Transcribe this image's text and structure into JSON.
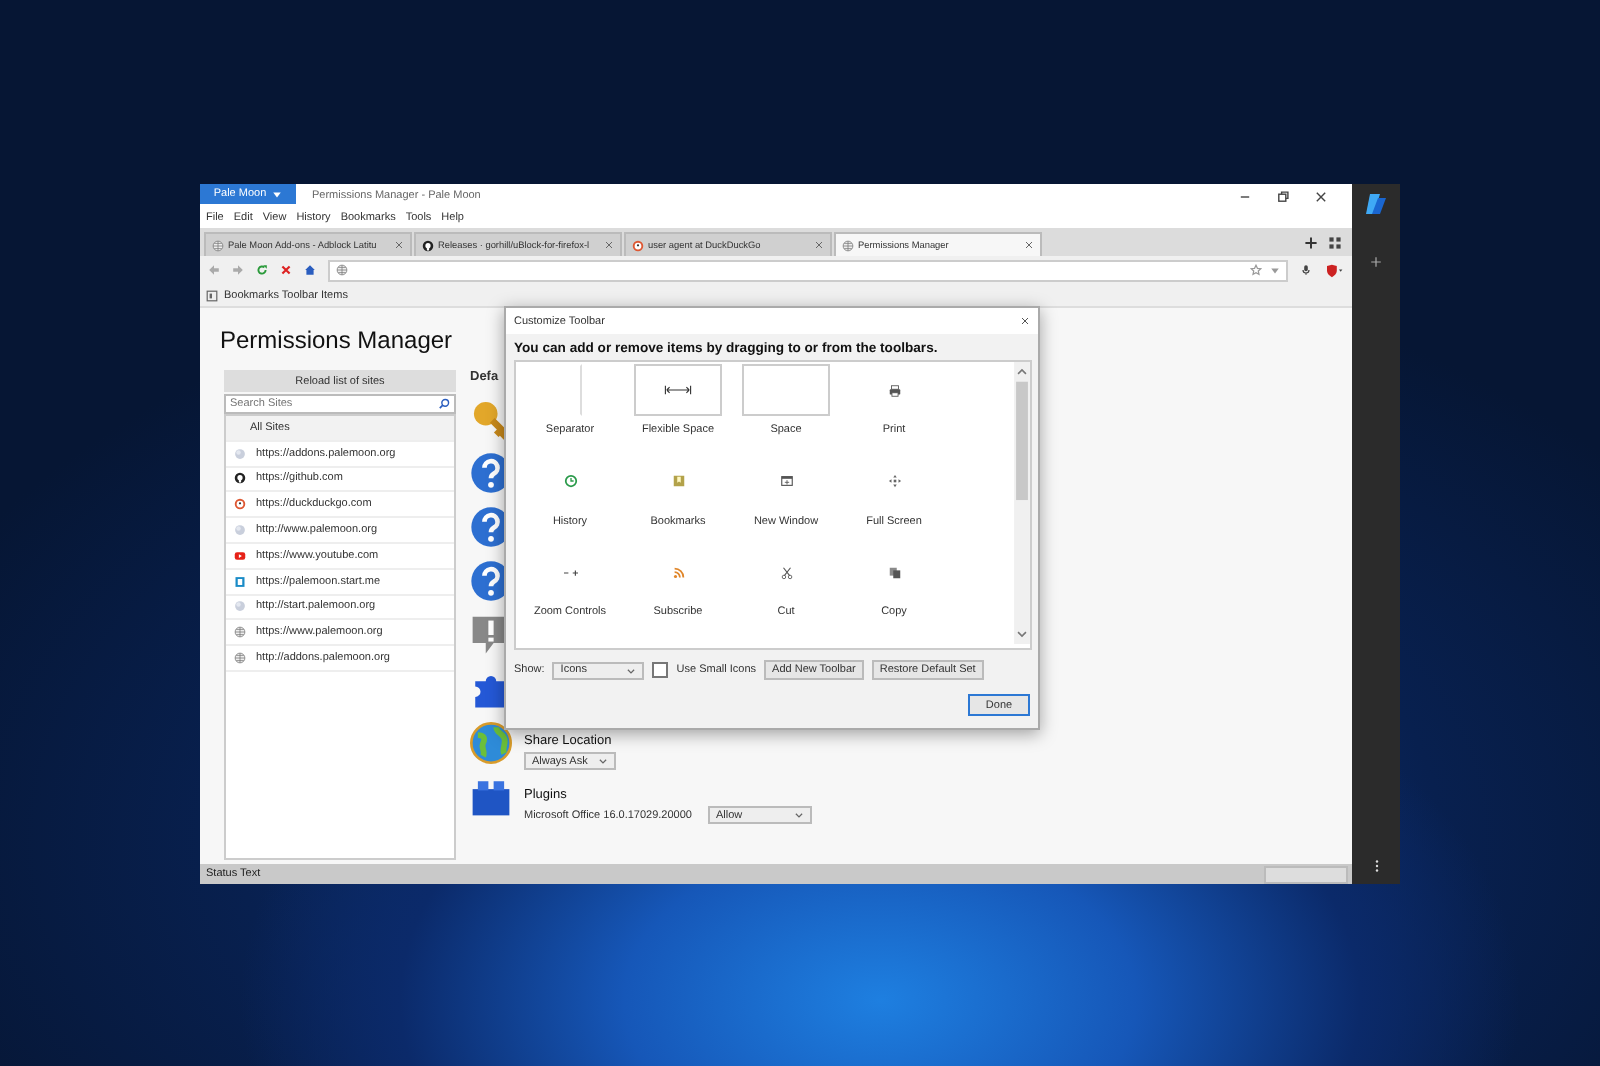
{
  "browser": {
    "app_button": "Pale Moon",
    "title": "Permissions Manager - Pale Moon",
    "menu": [
      "File",
      "Edit",
      "View",
      "History",
      "Bookmarks",
      "Tools",
      "Help"
    ],
    "tabs": [
      {
        "label": "Pale Moon Add-ons - Adblock Latitu",
        "kind": "globe",
        "selected": false
      },
      {
        "label": "Releases · gorhill/uBlock-for-firefox-l",
        "kind": "github",
        "selected": false
      },
      {
        "label": "user agent at DuckDuckGo",
        "kind": "duck",
        "selected": false
      },
      {
        "label": "Permissions Manager",
        "kind": "globe",
        "selected": true
      }
    ],
    "bookmarks_toolbar": "Bookmarks Toolbar Items",
    "status_bar": "Status Text"
  },
  "page": {
    "title": "Permissions Manager",
    "reload_button": "Reload list of sites",
    "search_placeholder": "Search Sites",
    "sites": [
      {
        "label": "All Sites",
        "kind": "none"
      },
      {
        "label": "https://addons.palemoon.org",
        "kind": "ball"
      },
      {
        "label": "https://github.com",
        "kind": "github"
      },
      {
        "label": "https://duckduckgo.com",
        "kind": "duck"
      },
      {
        "label": "http://www.palemoon.org",
        "kind": "ball"
      },
      {
        "label": "https://www.youtube.com",
        "kind": "youtube"
      },
      {
        "label": "https://palemoon.start.me",
        "kind": "startme"
      },
      {
        "label": "http://start.palemoon.org",
        "kind": "ball"
      },
      {
        "label": "https://www.palemoon.org",
        "kind": "globe"
      },
      {
        "label": "http://addons.palemoon.org",
        "kind": "globe"
      }
    ],
    "heading": "Defa",
    "permissions": [
      {
        "kind": "key"
      },
      {
        "kind": "question"
      },
      {
        "kind": "question"
      },
      {
        "kind": "question"
      },
      {
        "kind": "alert"
      },
      {
        "kind": "puzzle"
      },
      {
        "kind": "earth",
        "title": "Share Location",
        "select": "Always Ask"
      },
      {
        "kind": "lego",
        "title": "Plugins",
        "plugin": "Microsoft Office 16.0.17029.20000",
        "select": "Allow"
      }
    ]
  },
  "dialog": {
    "title": "Customize Toolbar",
    "intro": "You can add or remove items by dragging to or from the toolbars.",
    "items": [
      {
        "label": "Separator",
        "kind": "separator"
      },
      {
        "label": "Flexible Space",
        "kind": "flexible-space"
      },
      {
        "label": "Space",
        "kind": "space"
      },
      {
        "label": "Print",
        "kind": "print"
      },
      {
        "label": "History",
        "kind": "history"
      },
      {
        "label": "Bookmarks",
        "kind": "bookmarks"
      },
      {
        "label": "New Window",
        "kind": "new-window"
      },
      {
        "label": "Full Screen",
        "kind": "full-screen"
      },
      {
        "label": "Zoom Controls",
        "kind": "zoom"
      },
      {
        "label": "Subscribe",
        "kind": "subscribe"
      },
      {
        "label": "Cut",
        "kind": "cut"
      },
      {
        "label": "Copy",
        "kind": "copy"
      }
    ],
    "show_label": "Show:",
    "show_value": "Icons",
    "small_icons": {
      "label": "Use Small Icons",
      "checked": false
    },
    "buttons": [
      "Add New Toolbar",
      "Restore Default Set"
    ],
    "done": "Done"
  }
}
